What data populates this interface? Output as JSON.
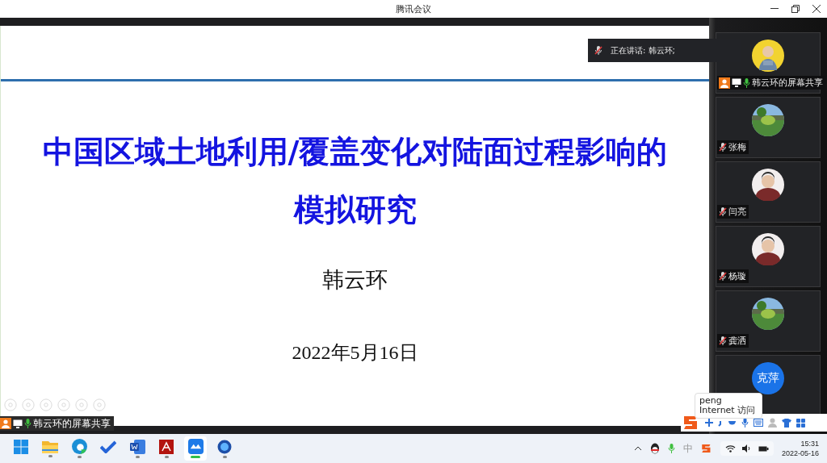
{
  "window": {
    "title": "腾讯会议"
  },
  "slide": {
    "title_lines": [
      "中国区域土地利用/覆盖变化对陆面过程影响的",
      "模拟研究"
    ],
    "author": "韩云环",
    "date": "2022年5月16日"
  },
  "speaking_banner": {
    "text": "正在讲话: 韩云环;"
  },
  "participants": [
    {
      "name": "韩云环的屏幕共享",
      "kind": "sharer",
      "muted": false
    },
    {
      "name": "张梅",
      "kind": "picture",
      "muted": true
    },
    {
      "name": "闫亮",
      "kind": "person",
      "muted": true
    },
    {
      "name": "杨璇",
      "kind": "person",
      "muted": true
    },
    {
      "name": "龚洒",
      "kind": "picture",
      "muted": true
    },
    {
      "kind": "initials",
      "initials": "克萍"
    }
  ],
  "share_label": {
    "text": "韩云环的屏幕共享"
  },
  "tooltip": {
    "lines": [
      "peng",
      "Internet 访问"
    ]
  },
  "taskbar": {
    "apps": [
      {
        "kind": "start",
        "running": false,
        "active": false
      },
      {
        "kind": "folder",
        "running": true,
        "active": false
      },
      {
        "kind": "edge",
        "running": true,
        "active": false
      },
      {
        "kind": "todo",
        "running": false,
        "active": false
      },
      {
        "kind": "word",
        "running": true,
        "active": false
      },
      {
        "kind": "acrobat",
        "running": true,
        "active": false
      },
      {
        "kind": "meeting",
        "running": true,
        "active": true
      },
      {
        "kind": "globe",
        "running": true,
        "active": false
      }
    ],
    "ime_indicator": "中",
    "time": "15:31",
    "date": "2022-05-16"
  }
}
